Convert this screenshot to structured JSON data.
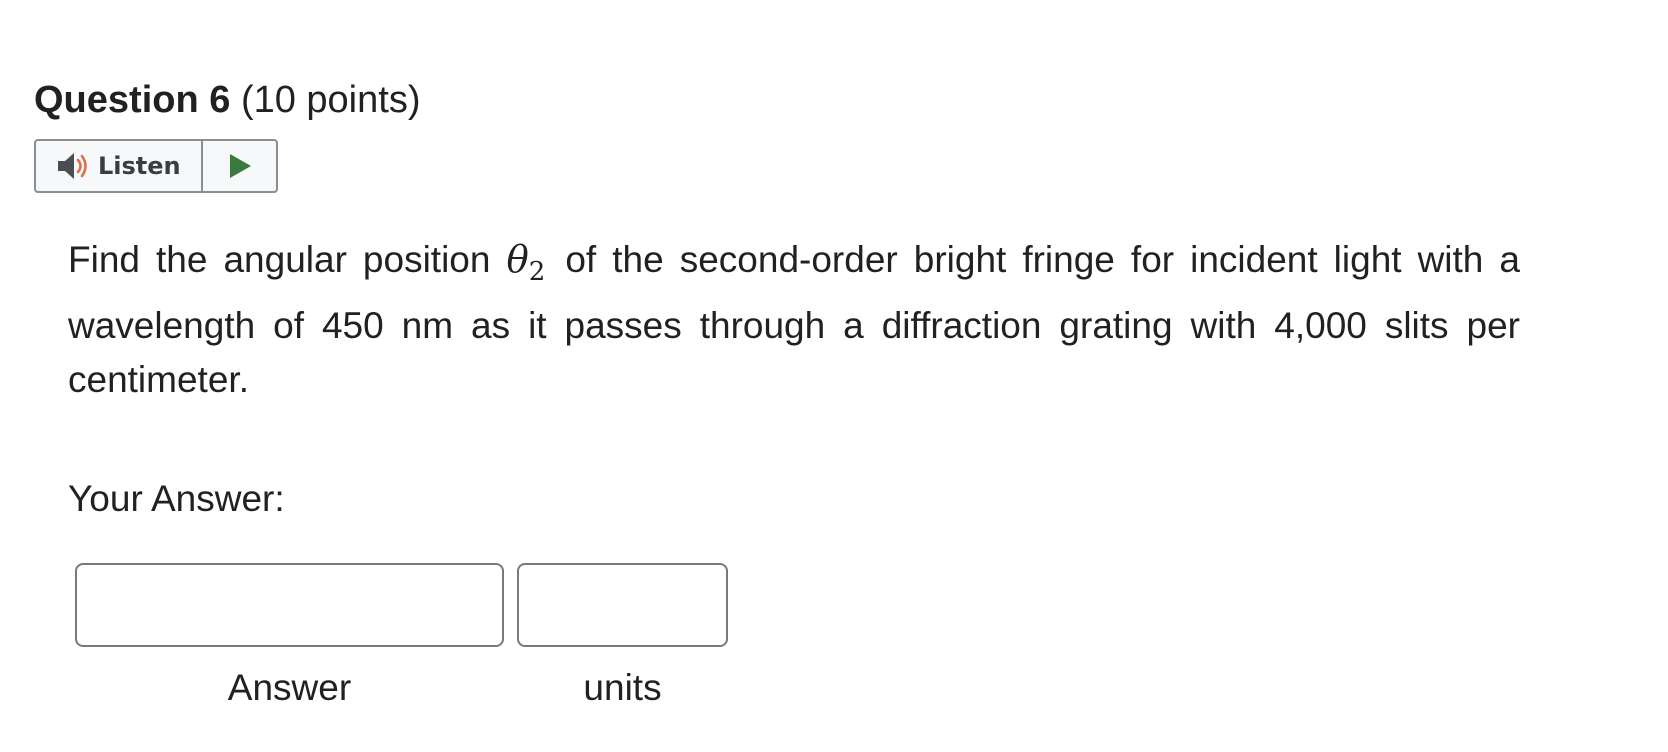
{
  "question": {
    "title": "Question 6",
    "points": "(10 points)"
  },
  "listen_widget": {
    "listen_label": "Listen",
    "listen_icon": "speaker-icon",
    "play_icon": "play-icon",
    "play_color": "#3b7a3e",
    "speaker_wave_color": "#d9734a"
  },
  "body": {
    "text_before": "Find the angular position ",
    "theta_symbol": "θ",
    "theta_subscript": "2",
    "text_after": " of the second-order bright fringe for incident light with a wavelength of 450 nm as it passes through a diffraction grating with 4,000 slits per centimeter."
  },
  "answer_section": {
    "label": "Your Answer:",
    "answer_value": "",
    "units_value": "",
    "answer_caption": "Answer",
    "units_caption": "units"
  }
}
